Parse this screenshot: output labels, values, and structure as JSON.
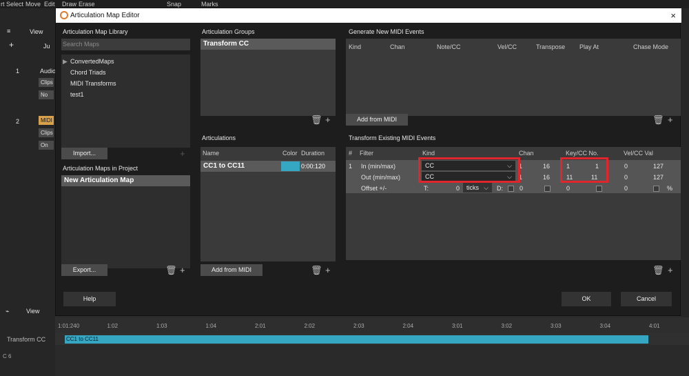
{
  "host": {
    "menu": [
      "rt",
      "Select",
      "Move",
      "Edit",
      "Draw",
      "Erase",
      "Snap",
      "Marks"
    ],
    "left_view_label": "View",
    "search_prefix": "Ju",
    "tracks": [
      {
        "num": "1",
        "name": "Audio",
        "clips": "Clips",
        "no": "No"
      },
      {
        "num": "2",
        "name": "MIDI",
        "clips": "Clips",
        "no": "On"
      }
    ],
    "bottom_view_label": "View",
    "time_position": "1:01:240",
    "ruler_ticks": [
      "1:01:240",
      "1:02",
      "1:03",
      "1:04",
      "2:01",
      "2:02",
      "2:03",
      "2:04",
      "3:01",
      "3:02",
      "3:03",
      "3:04",
      "4:01"
    ],
    "lane_label": "Transform CC",
    "clip_label": "CC1 to CC11",
    "piano_key": "C 6"
  },
  "dialog": {
    "title": "Articulation Map Editor",
    "close_icon": "×",
    "library": {
      "header": "Articulation Map Library",
      "search_placeholder": "Search Maps",
      "items": [
        "ConvertedMaps",
        "Chord Triads",
        "MIDI Transforms",
        "test1"
      ],
      "import_label": "Import..."
    },
    "project": {
      "header": "Articulation Maps in Project",
      "selected": "New Articulation Map",
      "export_label": "Export..."
    },
    "groups": {
      "header": "Articulation Groups",
      "selected": "Transform CC"
    },
    "articulations": {
      "header": "Articulations",
      "columns": [
        "Name",
        "Color",
        "Duration"
      ],
      "row": {
        "name": "CC1 to CC11",
        "color": "#36a7c3",
        "duration": "0:00:120"
      },
      "add_label": "Add from MIDI"
    },
    "generate": {
      "header": "Generate New MIDI Events",
      "columns": [
        "Kind",
        "Chan",
        "Note/CC",
        "Vel/CC",
        "Transpose",
        "Play At",
        "Chase Mode"
      ],
      "add_label": "Add from MIDI"
    },
    "transform": {
      "header": "Transform Existing MIDI Events",
      "columns": [
        "#",
        "Filter",
        "Kind",
        "Chan",
        "Key/CC No.",
        "Vel/CC Val"
      ],
      "row_num": "1",
      "rows": [
        {
          "filter": "In (min/max)",
          "kind": "CC",
          "chan_min": "1",
          "chan_max": "16",
          "key_min": "1",
          "key_max": "1",
          "vel_min": "0",
          "vel_max": "127"
        },
        {
          "filter": "Out (min/max)",
          "kind": "CC",
          "chan_min": "1",
          "chan_max": "16",
          "key_min": "11",
          "key_max": "11",
          "vel_min": "0",
          "vel_max": "127"
        }
      ],
      "offset": {
        "label": "Offset +/-",
        "t_label": "T:",
        "t_val": "0",
        "units": "ticks",
        "d_label": "D:",
        "chan": "0",
        "key": "0",
        "vel_unit": "%"
      }
    },
    "footer": {
      "help": "Help",
      "ok": "OK",
      "cancel": "Cancel"
    },
    "highlight_color": "#e0252d"
  }
}
